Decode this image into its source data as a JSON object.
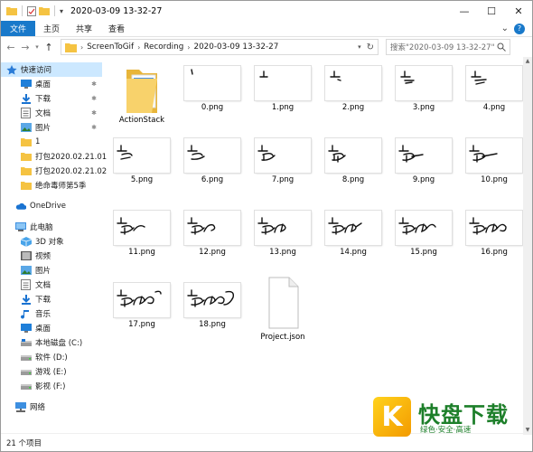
{
  "window": {
    "title": "2020-03-09 13-32-27",
    "controls": {
      "minimize": "—",
      "maximize": "☐",
      "close": "✕"
    }
  },
  "ribbon": {
    "tabs": [
      "文件",
      "主页",
      "共享",
      "查看"
    ],
    "expand": "⌄",
    "help": "?"
  },
  "address": {
    "crumbs": [
      "ScreenToGif",
      "Recording",
      "2020-03-09 13-32-27"
    ],
    "search_placeholder": "搜索\"2020-03-09 13-32-27\""
  },
  "nav": {
    "quick_access": "快速访问",
    "quick_items": [
      "桌面",
      "下载",
      "文档",
      "图片",
      "1",
      "打包2020.02.21.01",
      "打包2020.02.21.02",
      "绝命毒师第5季"
    ],
    "onedrive": "OneDrive",
    "this_pc": "此电脑",
    "pc_items": [
      "3D 对象",
      "视频",
      "图片",
      "文档",
      "下载",
      "音乐",
      "桌面",
      "本地磁盘 (C:)",
      "软件 (D:)",
      "游戏 (E:)",
      "影视 (F:)"
    ],
    "network": "网络"
  },
  "files": [
    {
      "name": "ActionStack",
      "kind": "folder"
    },
    {
      "name": "0.png",
      "kind": "png"
    },
    {
      "name": "1.png",
      "kind": "png"
    },
    {
      "name": "2.png",
      "kind": "png"
    },
    {
      "name": "3.png",
      "kind": "png"
    },
    {
      "name": "4.png",
      "kind": "png"
    },
    {
      "name": "5.png",
      "kind": "png"
    },
    {
      "name": "6.png",
      "kind": "png"
    },
    {
      "name": "7.png",
      "kind": "png"
    },
    {
      "name": "8.png",
      "kind": "png"
    },
    {
      "name": "9.png",
      "kind": "png"
    },
    {
      "name": "10.png",
      "kind": "png"
    },
    {
      "name": "11.png",
      "kind": "png"
    },
    {
      "name": "12.png",
      "kind": "png"
    },
    {
      "name": "13.png",
      "kind": "png"
    },
    {
      "name": "14.png",
      "kind": "png"
    },
    {
      "name": "15.png",
      "kind": "png"
    },
    {
      "name": "16.png",
      "kind": "png"
    },
    {
      "name": "17.png",
      "kind": "png"
    },
    {
      "name": "18.png",
      "kind": "png"
    },
    {
      "name": "Project.json",
      "kind": "json"
    }
  ],
  "status": {
    "count_text": "21 个项目"
  },
  "watermark": {
    "logo_letter": "K",
    "brand": "快盘下载",
    "slogan": "绿色·安全·高速"
  },
  "colors": {
    "accent": "#1979ca",
    "selection": "#cce8ff",
    "folder": "#f5c342"
  }
}
